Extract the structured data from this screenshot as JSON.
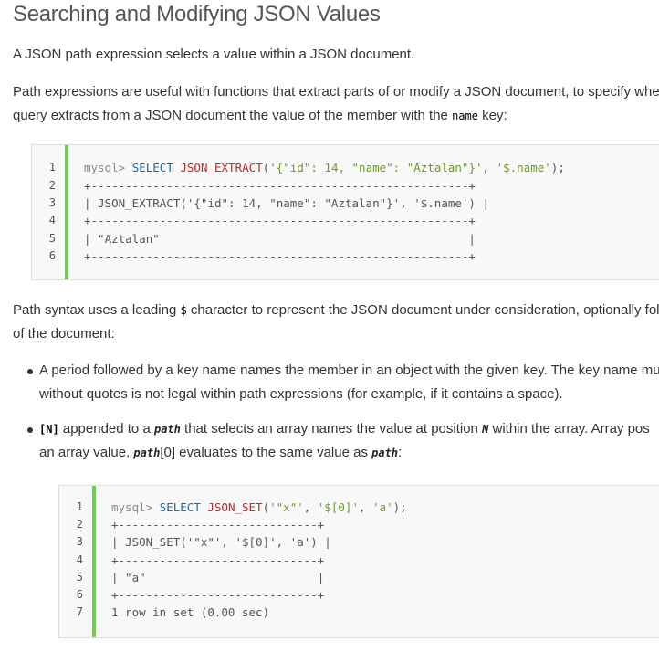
{
  "heading": "Searching and Modifying JSON Values",
  "intro": "A JSON path expression selects a value within a JSON document.",
  "para2": {
    "line1": "Path expressions are useful with functions that extract parts of or modify a JSON document, to specify wher",
    "line2_before": "query extracts from a JSON document the value of the member with the",
    "line2_code": "name",
    "line2_after": "key:"
  },
  "code1": {
    "line_numbers": [
      "1",
      "2",
      "3",
      "4",
      "5",
      "6"
    ],
    "prompt": "mysql>",
    "kw": "SELECT",
    "fn": "JSON_EXTRACT",
    "open": "(",
    "arg1": "'{\"id\": 14, \"name\": \"Aztalan\"}'",
    "comma": ", ",
    "arg2": "'$.name'",
    "close": ");",
    "border": "+-------------------------------------------------------+",
    "header_row": "| JSON_EXTRACT('{\"id\": 14, \"name\": \"Aztalan\"}', '$.name') |",
    "value_row": "| \"Aztalan\"                                             |"
  },
  "para3": {
    "line1_before": "Path syntax uses a leading",
    "line1_code": "$",
    "line1_after": "character to represent the JSON document under consideration, optionally foll",
    "line2": "of the document:"
  },
  "bullet1": {
    "line1": "A period followed by a key name names the member in an object with the given key. The key name mu",
    "line2": "without quotes is not legal within path expressions (for example, if it contains a space)."
  },
  "bullet2": {
    "l1_code": "[N]",
    "l1_a": "appended to a",
    "l1_var": "path",
    "l1_b": "that selects an array names the value at position",
    "l1_n": "N",
    "l1_c": "within the array. Array pos",
    "l2_a": "an array value,",
    "l2_var": "path",
    "l2_b": "[0] evaluates to the same value as",
    "l2_var2": "path",
    "l2_c": ":"
  },
  "code2": {
    "line_numbers": [
      "1",
      "2",
      "3",
      "4",
      "5",
      "6",
      "7"
    ],
    "prompt": "mysql>",
    "kw": "SELECT",
    "fn": "JSON_SET",
    "open": "(",
    "arg1": "'\"x\"'",
    "comma": ", ",
    "arg2": "'$[0]'",
    "comma2": ", ",
    "arg3": "'a'",
    "close": ");",
    "border": "+-----------------------------+",
    "header_row": "| JSON_SET('\"x\"', '$[0]', 'a') |",
    "value_row": "| \"a\"                         |",
    "footer": "1 row in set (0.00 sec)"
  }
}
